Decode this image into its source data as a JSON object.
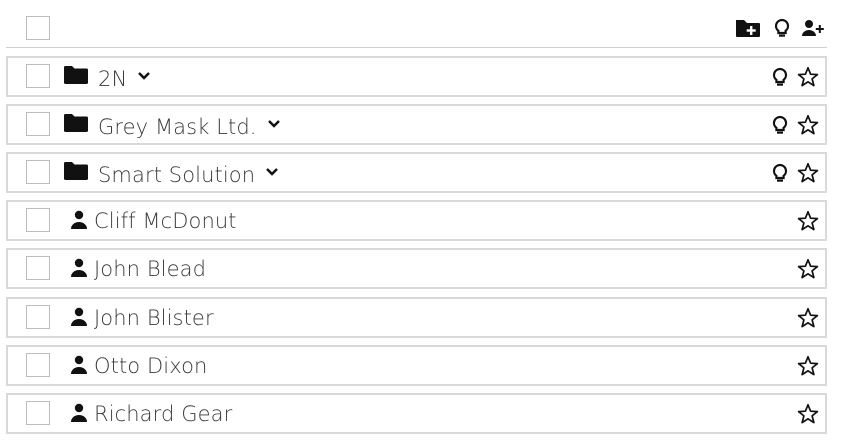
{
  "header": {
    "select_all_checked": false,
    "actions": [
      "add-folder-icon",
      "bulb-icon",
      "add-user-icon"
    ]
  },
  "rows": [
    {
      "type": "group",
      "name": "2N",
      "checked": false,
      "expandable": true,
      "icons": [
        "bulb-icon",
        "star-icon"
      ]
    },
    {
      "type": "group",
      "name": "Grey Mask Ltd.",
      "checked": false,
      "expandable": true,
      "icons": [
        "bulb-icon",
        "star-icon"
      ]
    },
    {
      "type": "group",
      "name": "Smart Solution",
      "checked": false,
      "expandable": true,
      "icons": [
        "bulb-icon",
        "star-icon"
      ]
    },
    {
      "type": "user",
      "name": "Cliff McDonut",
      "checked": false,
      "icons": [
        "star-icon"
      ]
    },
    {
      "type": "user",
      "name": "John Blead",
      "checked": false,
      "icons": [
        "star-icon"
      ]
    },
    {
      "type": "user",
      "name": "John Blister",
      "checked": false,
      "icons": [
        "star-icon"
      ]
    },
    {
      "type": "user",
      "name": "Otto Dixon",
      "checked": false,
      "icons": [
        "star-icon"
      ]
    },
    {
      "type": "user",
      "name": "Richard Gear",
      "checked": false,
      "icons": [
        "star-icon"
      ]
    }
  ],
  "colors": {
    "icon": "#111111",
    "text": "#3a3a3a",
    "border": "#d9d9d9"
  }
}
